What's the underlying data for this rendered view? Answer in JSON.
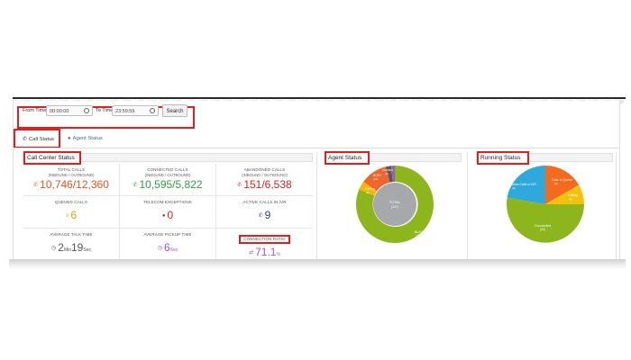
{
  "time_filter": {
    "from_label": "From Time",
    "from_value": "00:00:00",
    "to_label": "To Time",
    "to_value": "23:59:59",
    "search_label": "Search"
  },
  "tabs": [
    {
      "label": "Call Status",
      "icon": "phone-icon"
    },
    {
      "label": "Agent Status",
      "icon": "user-icon"
    }
  ],
  "panels": {
    "call_center": "Call Center Status",
    "agent": "Agent Status",
    "running": "Running Status"
  },
  "stats": [
    {
      "title": "TOTAL CALLS",
      "sub": "(INBOUND / OUTBOUND)",
      "value": "10,746/12,360",
      "icon": "phone-icon",
      "color": "#e8521d"
    },
    {
      "title": "CONNECTED CALLS",
      "sub": "(INBOUND / OUTBOUND)",
      "value": "10,595/5,822",
      "icon": "phone-icon",
      "color": "#2e9e4a"
    },
    {
      "title": "ABANDONED CALLS",
      "sub": "(INBOUND / OUTBOUND)",
      "value": "151/6,538",
      "icon": "phone-icon",
      "color": "#d92020"
    },
    {
      "title": "QUEUED CALLS",
      "sub": "",
      "value": "6",
      "icon": "queue-icon",
      "color": "#f0a000"
    },
    {
      "title": "TELECOM EXCEPTIONS",
      "sub": "",
      "value": "0",
      "icon": "exclamation-icon",
      "color": "#d92020"
    },
    {
      "title": "ACTIVE CALLS IN IVR",
      "sub": "",
      "value": "9",
      "icon": "phone-icon",
      "color": "#2c3e8f"
    },
    {
      "title": "AVERAGE TALK TIME",
      "sub": "",
      "value_min": "2",
      "unit_min": "Min",
      "value_sec": "19",
      "unit_sec": "Sec",
      "icon": "clock-icon",
      "color": "#555555"
    },
    {
      "title": "AVERAGE PICKUP TIME",
      "sub": "",
      "value": "6",
      "unit": "Sec",
      "icon": "clock-icon",
      "color": "#b04fc0"
    },
    {
      "title": "CONNECTION RATIO",
      "sub": "",
      "value": "71.1",
      "unit": "%",
      "icon": "ratio-icon",
      "color": "#b04fc0"
    }
  ],
  "agent_chart": {
    "center_label": "TOTAL",
    "center_value": "(147)",
    "segments": [
      {
        "label": "BUSY",
        "value": "(113)",
        "color": "#8db61c"
      },
      {
        "label": "Calling",
        "value": "(6)",
        "color": "#f7b500"
      },
      {
        "label": "BUSY",
        "value": "(22)",
        "color": "#f0642d"
      },
      {
        "label": "PAUSED",
        "value": "(3)",
        "color": "#5b5b5b"
      },
      {
        "label": "",
        "value": "(3)",
        "color": "#9b5fb5"
      }
    ]
  },
  "running_chart": {
    "segments": [
      {
        "label": "Connected",
        "value": "(22)",
        "color": "#8db61c"
      },
      {
        "label": "Active Calls in IVR",
        "value": "(9)",
        "color": "#2fa8dc"
      },
      {
        "label": "Calls in Queue",
        "value": "(6)",
        "color": "#f46b1d"
      },
      {
        "label": "Calling",
        "value": "(6)",
        "color": "#f2c20c"
      }
    ]
  }
}
